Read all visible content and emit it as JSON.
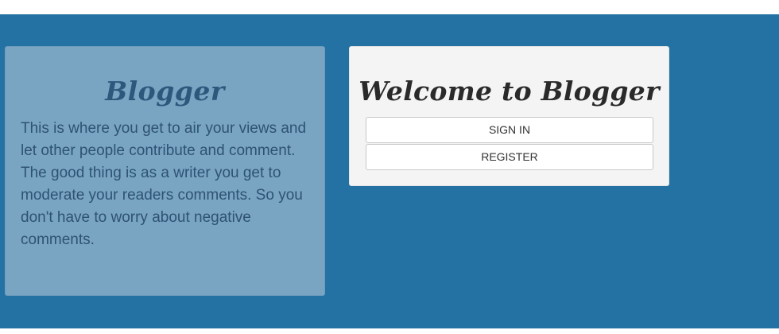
{
  "about": {
    "title": "Blogger",
    "lines": [
      "This is where you get to air your views and let other people contribute and comment.",
      "The good thing is as a writer you get to moderate your readers comments. So you don't have to worry about negative comments."
    ]
  },
  "welcome": {
    "title": "Welcome to Blogger",
    "signin_label": "SIGN IN",
    "register_label": "REGISTER"
  },
  "colors": {
    "background": "#2472a4",
    "about_panel": "#79a5c3",
    "welcome_panel": "#f4f4f4"
  }
}
